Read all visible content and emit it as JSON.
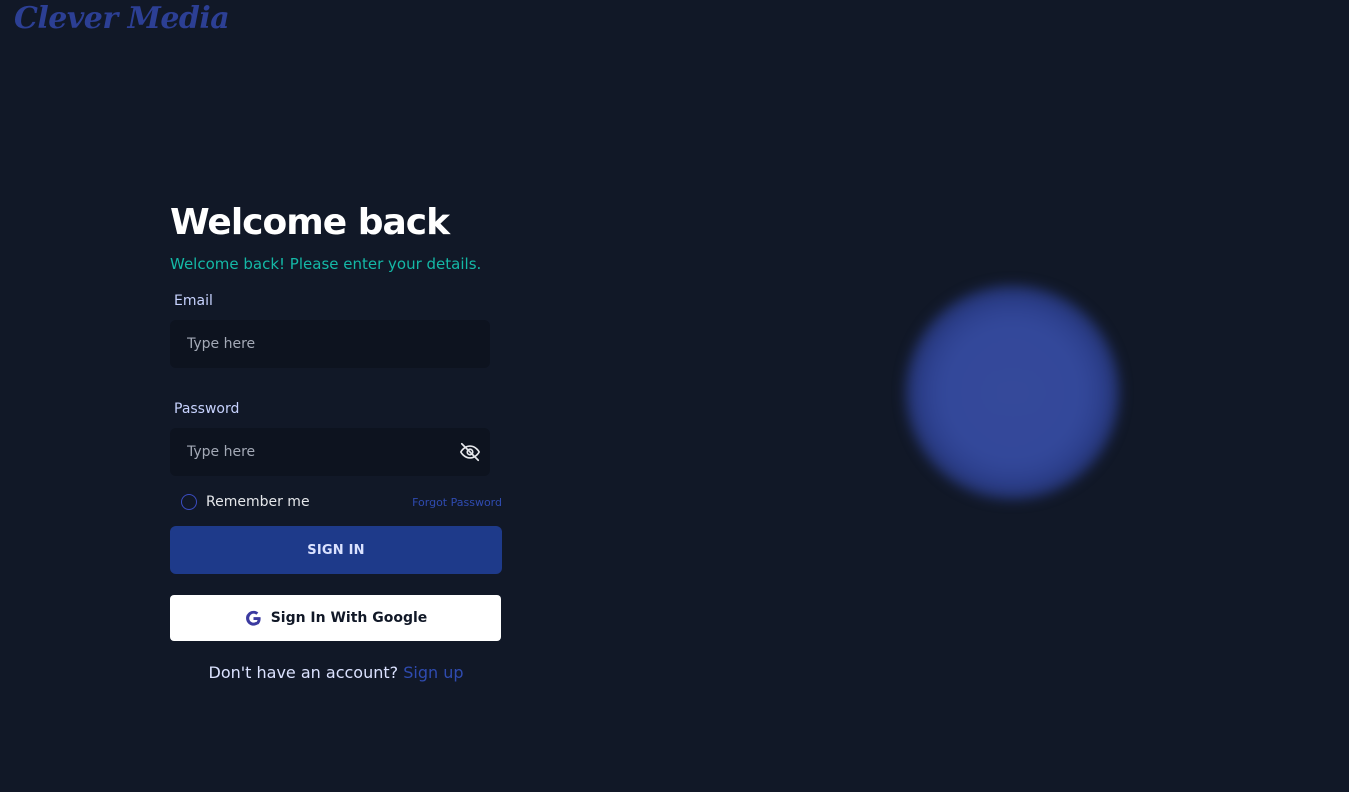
{
  "brand": {
    "logo_text": "Clever Media"
  },
  "login": {
    "title": "Welcome back",
    "subtitle": "Welcome back! Please enter your details.",
    "email": {
      "label": "Email",
      "placeholder": "Type here",
      "value": ""
    },
    "password": {
      "label": "Password",
      "placeholder": "Type here",
      "value": "",
      "toggle_icon": "eye-off-icon"
    },
    "remember_label": "Remember me",
    "forgot_label": "Forgot Password",
    "signin_label": "SIGN IN",
    "google_label": "Sign In With Google",
    "no_account_text": "Don't have an account?",
    "signup_label": "Sign up"
  },
  "colors": {
    "background": "#111827",
    "accent_teal": "#14b8a6",
    "primary_button": "#1e3a8a",
    "link": "#2f4bb0",
    "blob": "#34489a"
  }
}
